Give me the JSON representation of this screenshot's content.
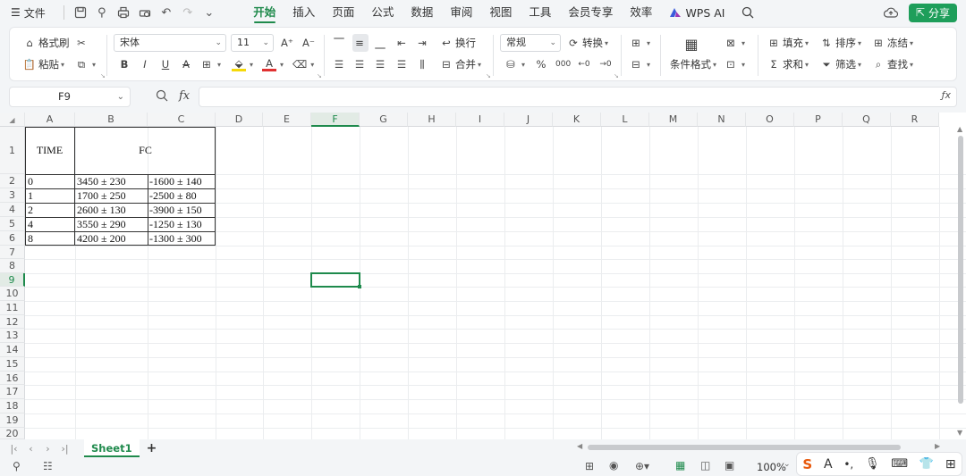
{
  "topbar": {
    "file_label": "文件",
    "menu": [
      "开始",
      "插入",
      "页面",
      "公式",
      "数据",
      "审阅",
      "视图",
      "工具",
      "会员专享",
      "效率"
    ],
    "active_menu": "开始",
    "wps_ai_label": "WPS AI",
    "share_label": "分享"
  },
  "ribbon": {
    "format_painter": "格式刷",
    "paste": "粘贴",
    "font_name": "宋体",
    "font_size": "11",
    "wrap_text": "换行",
    "merge": "合并",
    "number_format": "常规",
    "convert": "转换",
    "conditional_format": "条件格式",
    "fill": "填充",
    "sort": "排序",
    "freeze": "冻结",
    "sum": "求和",
    "filter": "筛选",
    "find": "查找"
  },
  "formula_bar": {
    "name_box": "F9",
    "fx_label": "fx",
    "content": ""
  },
  "sheet": {
    "columns": [
      "A",
      "B",
      "C",
      "D",
      "E",
      "F",
      "G",
      "H",
      "I",
      "J",
      "K",
      "L",
      "M",
      "N",
      "O",
      "P",
      "Q",
      "R"
    ],
    "rows": [
      "1",
      "2",
      "3",
      "4",
      "5",
      "6",
      "7",
      "8",
      "9",
      "10",
      "11",
      "12",
      "13",
      "14",
      "15",
      "16",
      "17",
      "18",
      "19",
      "20"
    ],
    "selected_cell": "F9",
    "cells": {
      "A1": "TIME",
      "B1": "FC",
      "A2": "0",
      "B2": "3450 ± 230",
      "C2": "-1600 ± 140",
      "A3": "1",
      "B3": "1700 ± 250",
      "C3": "-2500 ± 80",
      "A4": "2",
      "B4": "2600 ± 130",
      "C4": "-3900 ± 150",
      "A5": "4",
      "B5": "3550 ± 290",
      "C5": "-1250 ± 130",
      "A6": "8",
      "B6": "4200 ± 200",
      "C6": "-1300 ± 300"
    }
  },
  "tabs": {
    "sheet_name": "Sheet1",
    "add_label": "+"
  },
  "status": {
    "zoom": "100%"
  }
}
